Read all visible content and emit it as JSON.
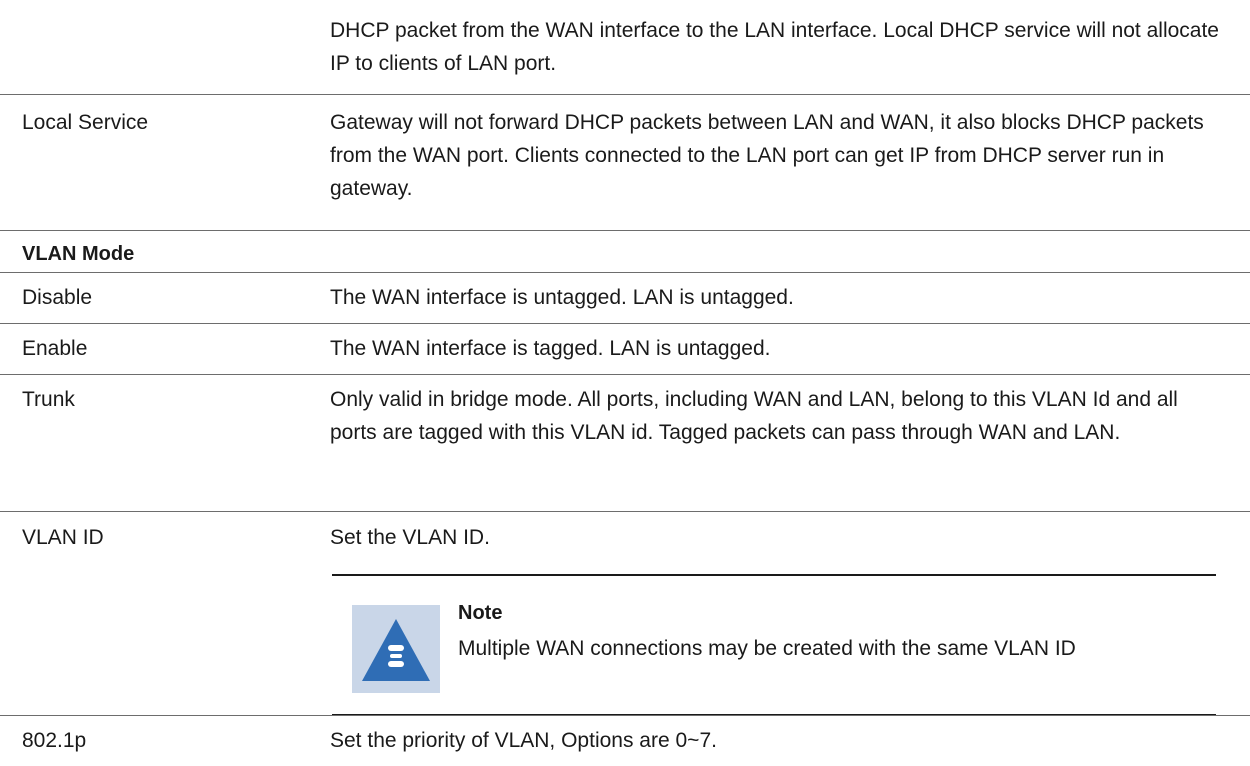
{
  "rows": [
    {
      "term": "",
      "desc": "DHCP packet from the WAN interface to the LAN interface. Local DHCP service will not allocate IP to clients of LAN port."
    },
    {
      "term": "Local Service",
      "desc": "Gateway will not forward DHCP packets between LAN and WAN, it also blocks DHCP packets from the WAN port. Clients connected to the LAN port can get IP from DHCP server run in gateway."
    }
  ],
  "section": {
    "title": "VLAN Mode"
  },
  "vlan_rows": [
    {
      "term": "Disable",
      "desc": "The WAN interface is untagged. LAN is untagged."
    },
    {
      "term": "Enable",
      "desc": "The WAN interface is tagged. LAN is untagged."
    },
    {
      "term": "Trunk",
      "desc": "Only valid in bridge mode. All ports, including WAN and LAN, belong to this VLAN Id and all ports are tagged with this VLAN id. Tagged packets can pass through WAN and LAN."
    },
    {
      "term": "VLAN ID",
      "desc": "Set the VLAN ID."
    }
  ],
  "note": {
    "title": "Note",
    "text": "Multiple WAN connections may be created with the same VLAN ID",
    "icon": "note-icon",
    "icon_bg": "#c9d6e8",
    "icon_fg": "#2f6db5"
  },
  "last_row": {
    "term": "802.1p",
    "desc": "Set the priority of VLAN, Options are 0~7."
  }
}
